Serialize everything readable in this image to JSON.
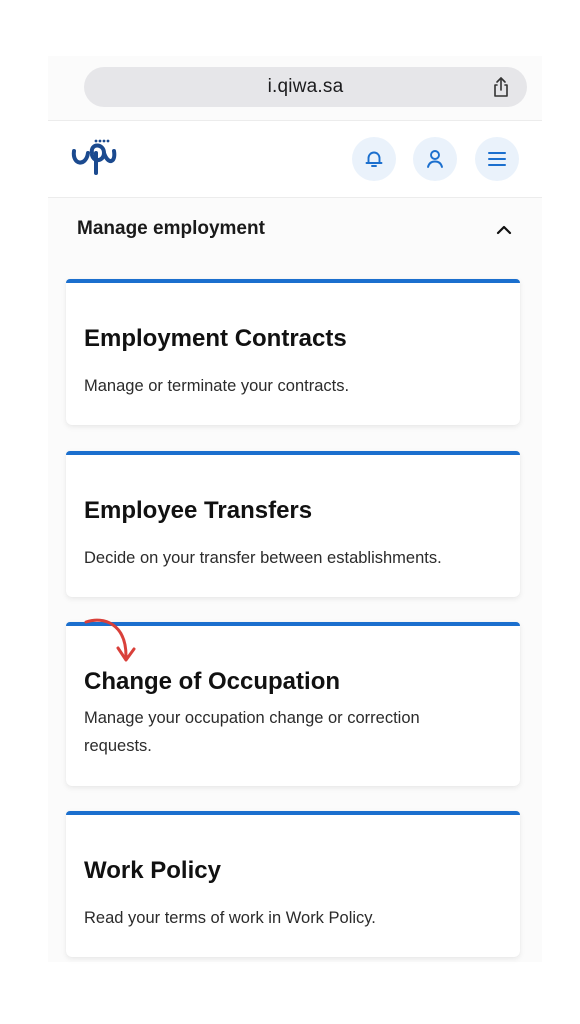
{
  "browser": {
    "url": "i.qiwa.sa",
    "share_icon": "share-icon"
  },
  "header": {
    "logo": "qiwa-logo",
    "buttons": [
      {
        "icon": "bell-icon",
        "label": "Notifications"
      },
      {
        "icon": "user-icon",
        "label": "Profile"
      },
      {
        "icon": "menu-icon",
        "label": "Menu"
      }
    ],
    "accent_bg": "#eaf2fb",
    "accent_fg": "#1b6fce"
  },
  "section": {
    "title": "Manage employment",
    "toggle_icon": "chevron-up-icon"
  },
  "cards": [
    {
      "title": "Employment Contracts",
      "description": "Manage or terminate your contracts."
    },
    {
      "title": "Employee Transfers",
      "description": "Decide on your transfer between establishments."
    },
    {
      "title": "Change of Occupation",
      "description": "Manage your occupation change or correction requests."
    },
    {
      "title": "Work Policy",
      "description": "Read your terms of work in Work Policy."
    }
  ],
  "colors": {
    "card_border": "#1b6fce",
    "annotation_arrow": "#d9403a"
  }
}
